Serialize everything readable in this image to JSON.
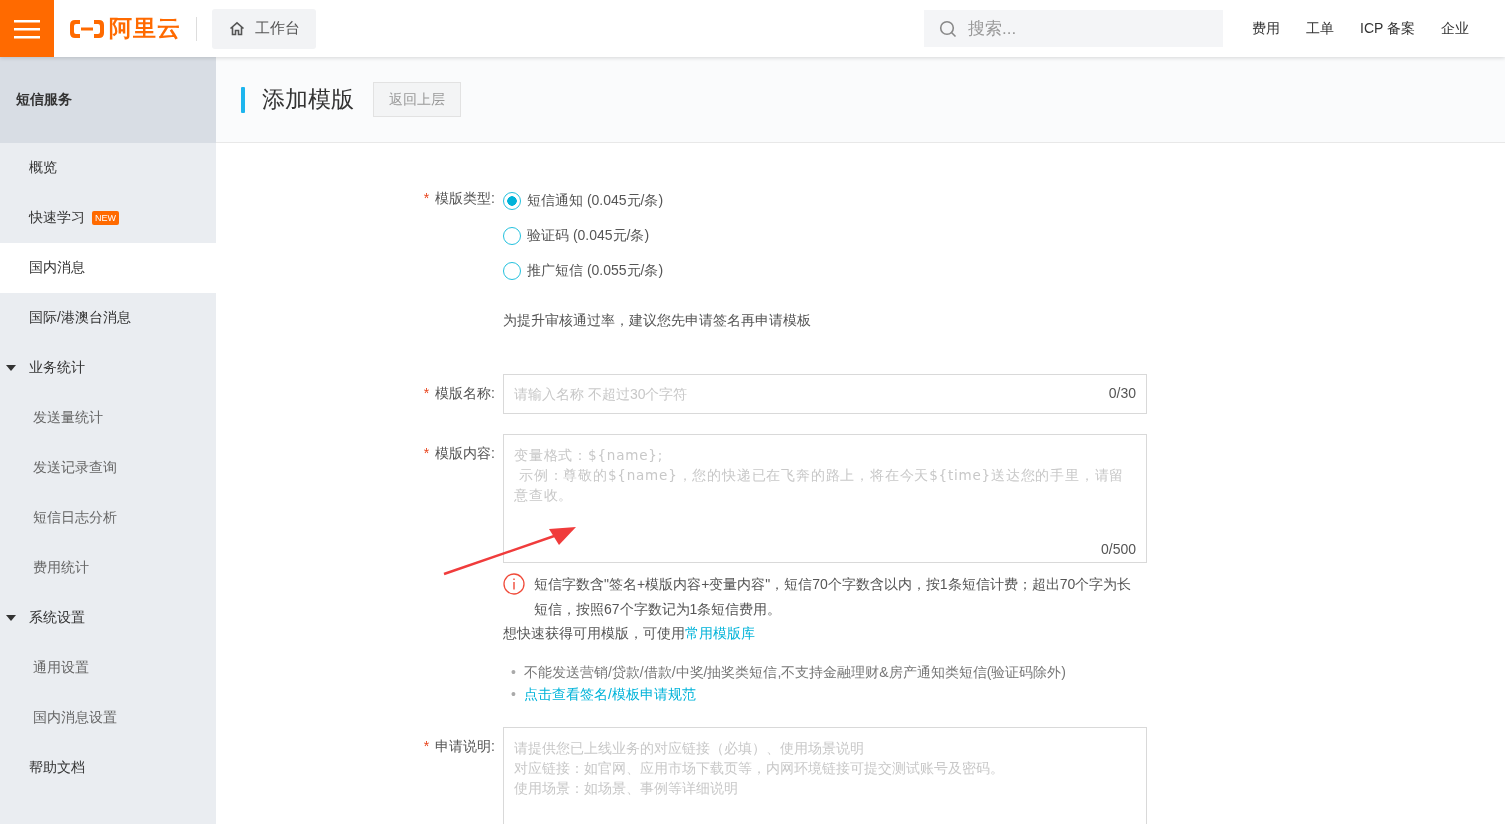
{
  "topbar": {
    "logo_text": "阿里云",
    "workbench": "工作台",
    "search": {
      "placeholder": "搜索..."
    },
    "nav": [
      "费用",
      "工单",
      "ICP 备案",
      "企业"
    ]
  },
  "sidebar": {
    "title": "短信服务",
    "items": [
      {
        "kind": "link",
        "label": "概览",
        "selected": false
      },
      {
        "kind": "link",
        "label": "快速学习",
        "badge": "NEW",
        "selected": false
      },
      {
        "kind": "link",
        "label": "国内消息",
        "selected": true
      },
      {
        "kind": "link",
        "label": "国际/港澳台消息",
        "selected": false
      },
      {
        "kind": "group",
        "label": "业务统计",
        "expanded": true,
        "children": [
          {
            "label": "发送量统计",
            "selected": false
          },
          {
            "label": "发送记录查询",
            "selected": false
          },
          {
            "label": "短信日志分析",
            "selected": false
          },
          {
            "label": "费用统计",
            "selected": false
          }
        ]
      },
      {
        "kind": "group",
        "label": "系统设置",
        "expanded": true,
        "children": [
          {
            "label": "通用设置",
            "selected": false
          },
          {
            "label": "国内消息设置",
            "selected": false
          }
        ]
      },
      {
        "kind": "link",
        "label": "帮助文档",
        "selected": false
      }
    ]
  },
  "page": {
    "title": "添加模版",
    "back_button": "返回上层"
  },
  "form": {
    "template_type": {
      "mark": "*",
      "label": "模版类型:",
      "options": [
        {
          "label": "短信通知 (0.045元/条)",
          "selected": true
        },
        {
          "label": "验证码 (0.045元/条)",
          "selected": false
        },
        {
          "label": "推广短信 (0.055元/条)",
          "selected": false
        }
      ],
      "hint": "为提升审核通过率，建议您先申请签名再申请模板"
    },
    "template_name": {
      "mark": "*",
      "label": "模版名称:",
      "placeholder": "请输入名称 不超过30个字符",
      "counter": "0/30"
    },
    "template_content": {
      "mark": "*",
      "label": "模版内容:",
      "placeholder": "变量格式：${name};\n 示例：尊敬的${name}，您的快递已在飞奔的路上，将在今天${time}送达您的手里，请留意查收。",
      "counter": "0/500",
      "notice": "短信字数含\"签名+模版内容+变量内容\"，短信70个字数含以内，按1条短信计费；超出70个字为长短信，按照67个字数记为1条短信费用。",
      "quick_tip": {
        "text": "想快速获得可用模版，可使用",
        "link": "常用模版库"
      },
      "rules": [
        {
          "kind": "text",
          "bullet": "•",
          "text": "不能发送营销/贷款/借款/中奖/抽奖类短信,不支持金融理财&房产通知类短信(验证码除外)"
        },
        {
          "kind": "link",
          "bullet": "•",
          "text": "点击查看签名/模板申请规范"
        }
      ]
    },
    "application_note": {
      "mark": "*",
      "label": "申请说明:",
      "placeholder": [
        "请提供您已上线业务的对应链接（必填）、使用场景说明",
        "对应链接：如官网、应用市场下载页等，内网环境链接可提交测试账号及密码。",
        "使用场景：如场景、事例等详细说明"
      ]
    }
  }
}
